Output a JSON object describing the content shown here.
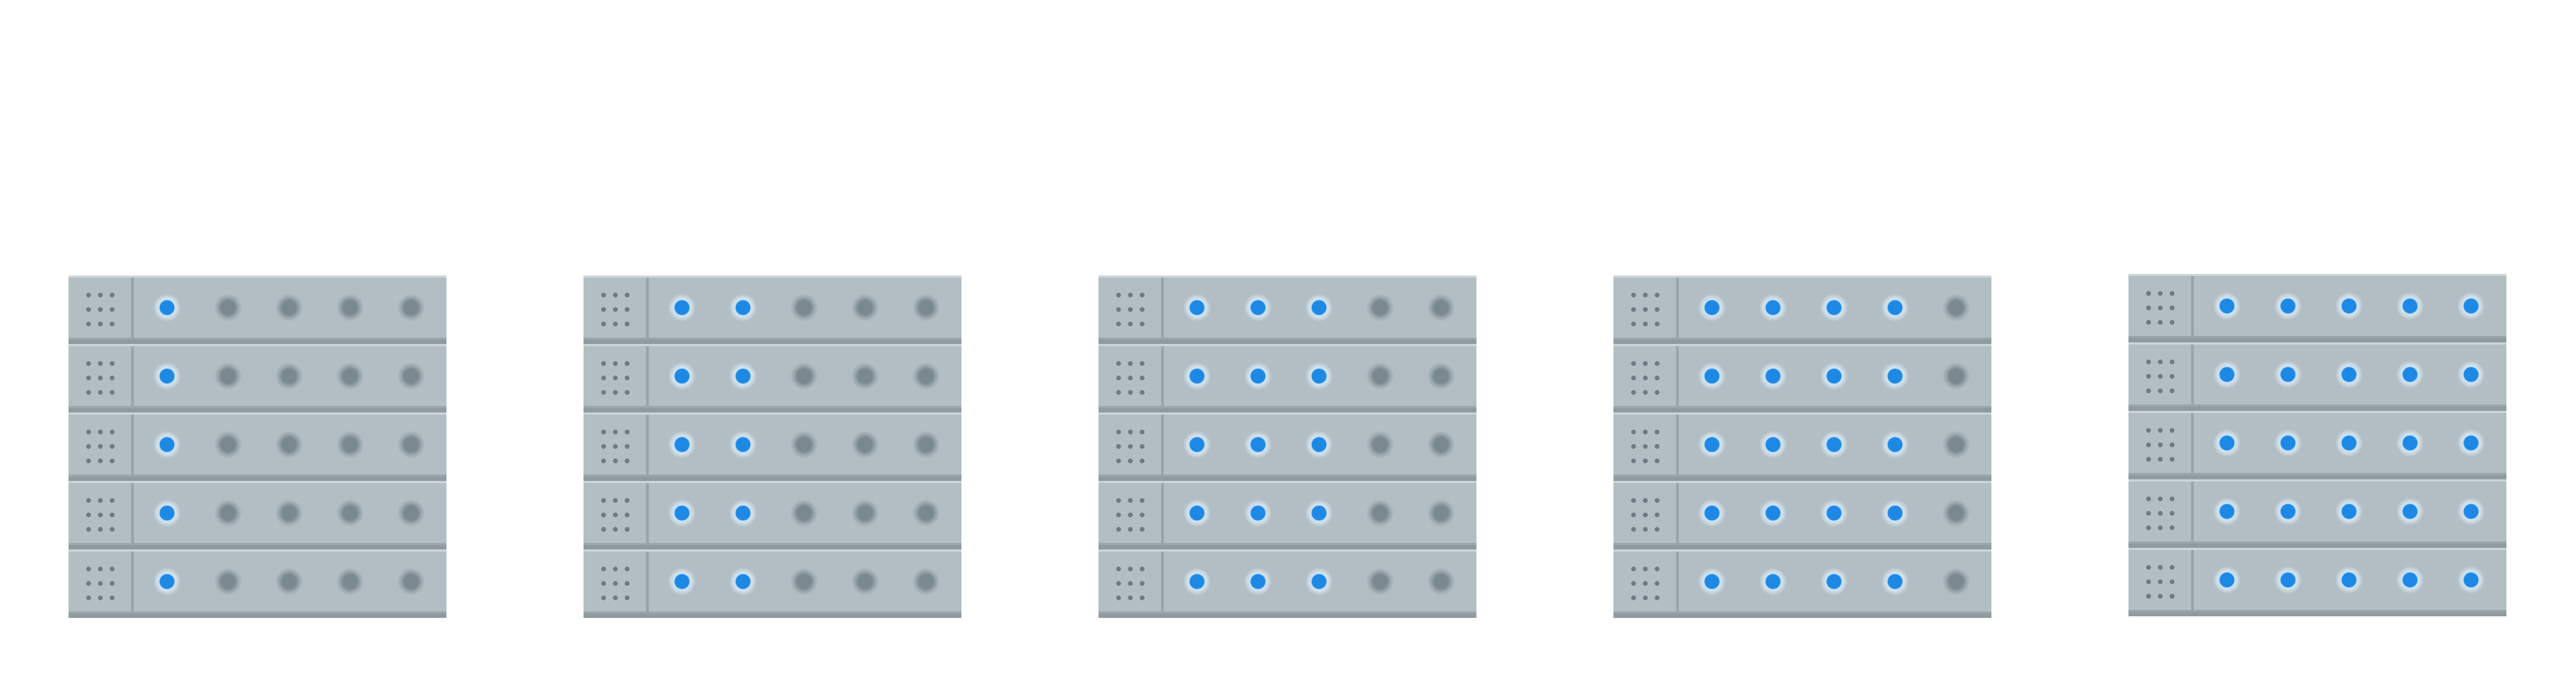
{
  "colors": {
    "background": "#ffffff",
    "rack_face": "#b3bec4",
    "vent_dot": "#6d7b82",
    "led_on": "#1e88e5",
    "led_off": "#7a8990"
  },
  "icons": {
    "rack": "server-rack-icon",
    "vent": "vent-grid-icon",
    "led": "status-led-icon"
  },
  "racks": [
    {
      "units": 5,
      "leds_per_unit": 5,
      "leds_on_per_unit": 1
    },
    {
      "units": 5,
      "leds_per_unit": 5,
      "leds_on_per_unit": 2
    },
    {
      "units": 5,
      "leds_per_unit": 5,
      "leds_on_per_unit": 3
    },
    {
      "units": 5,
      "leds_per_unit": 5,
      "leds_on_per_unit": 4
    },
    {
      "units": 5,
      "leds_per_unit": 5,
      "leds_on_per_unit": 5
    }
  ]
}
